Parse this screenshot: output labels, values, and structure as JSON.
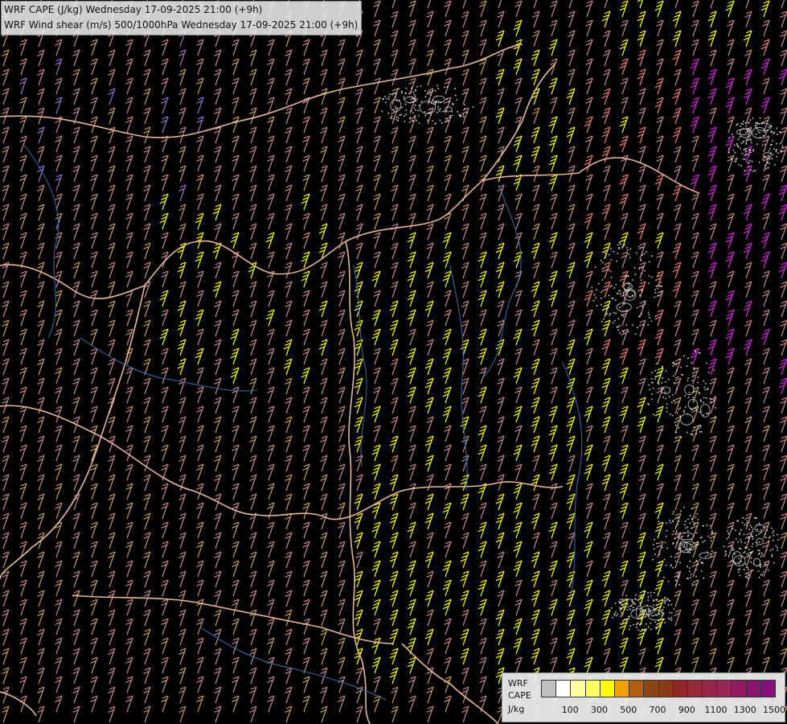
{
  "header": {
    "line1": "WRF CAPE (J/kg) Wednesday 17-09-2025 21:00 (+9h)",
    "line2": "WRF Wind shear (m/s) 500/1000hPa Wednesday 17-09-2025 21:00 (+9h)"
  },
  "legend": {
    "model": "WRF",
    "field": "CAPE",
    "unit": "J/kg",
    "colors": [
      "#c0c0c0",
      "#ffffff",
      "#ffffa0",
      "#ffff60",
      "#ffff00",
      "#f0a000",
      "#b06010",
      "#8b4513",
      "#8b3a1a",
      "#902828",
      "#962a3a",
      "#982848",
      "#962858",
      "#921c64",
      "#8c1470",
      "#88107c"
    ],
    "ticks": [
      "100",
      "300",
      "500",
      "700",
      "900",
      "1100",
      "1300",
      "1500"
    ]
  },
  "map": {
    "background": "#000000",
    "border_color": "#e8b898",
    "river_color": "#3a6fb5",
    "barb_colors": {
      "low": "#c88a8a",
      "tan": "#c8a060",
      "yellow": "#ffff00",
      "salmon": "#f08070",
      "purple": "#a070d0",
      "magenta": "#e020e0"
    }
  }
}
